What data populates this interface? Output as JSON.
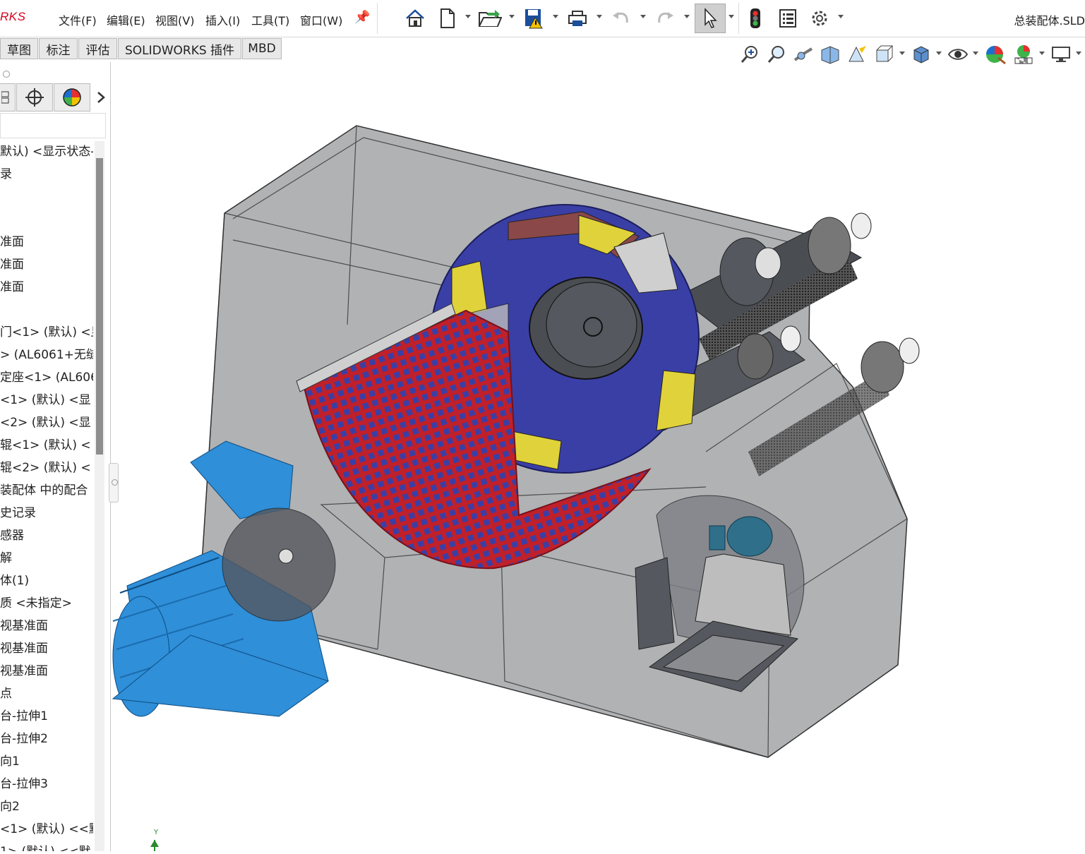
{
  "app": {
    "logo_text": "RKS",
    "doc_title": "总装配体.SLD"
  },
  "menu": [
    "文件(F)",
    "编辑(E)",
    "视图(V)",
    "插入(I)",
    "工具(T)",
    "窗口(W)"
  ],
  "toolbar_icons": [
    "home-icon",
    "new-doc-icon",
    "open-icon",
    "save-warning-icon",
    "print-icon",
    "undo-icon",
    "redo-icon",
    "select-cursor-icon",
    "rebuild-traffic-light-icon",
    "file-properties-icon",
    "options-gear-icon"
  ],
  "tabs": [
    "草图",
    "标注",
    "评估",
    "SOLIDWORKS 插件",
    "MBD"
  ],
  "heads_up_icons": [
    "zoom-to-fit-icon",
    "zoom-area-icon",
    "previous-view-icon",
    "section-view-icon",
    "dynamic-annotation-icon",
    "view-orientation-icon",
    "display-style-icon",
    "hide-show-icon",
    "edit-appearance-icon",
    "apply-scene-icon",
    "view-settings-icon"
  ],
  "tree_rows": [
    "默认) <显示状态-",
    "录",
    "",
    "",
    "准面",
    "准面",
    "准面",
    "",
    "门<1> (默认) <显",
    "> (AL6061+无缝",
    "定座<1> (AL606",
    "<1> (默认) <显",
    "<2> (默认) <显",
    "辊<1> (默认) <",
    "辊<2> (默认) <",
    "装配体 中的配合",
    "史记录",
    "感器",
    "解",
    "体(1)",
    "质 <未指定>",
    "视基准面",
    "视基准面",
    "视基准面",
    "点",
    "台-拉伸1",
    "台-拉伸2",
    "向1",
    "台-拉伸3",
    "向2",
    "<1> (默认) <<默",
    "1> (默认) <<默"
  ],
  "axis_label": "Y",
  "colors": {
    "housing": "#6f7276",
    "rotor": "#3a3fa6",
    "screen": "#c0202a",
    "motor": "#2f8fd8",
    "liner": "#e0d23a"
  }
}
